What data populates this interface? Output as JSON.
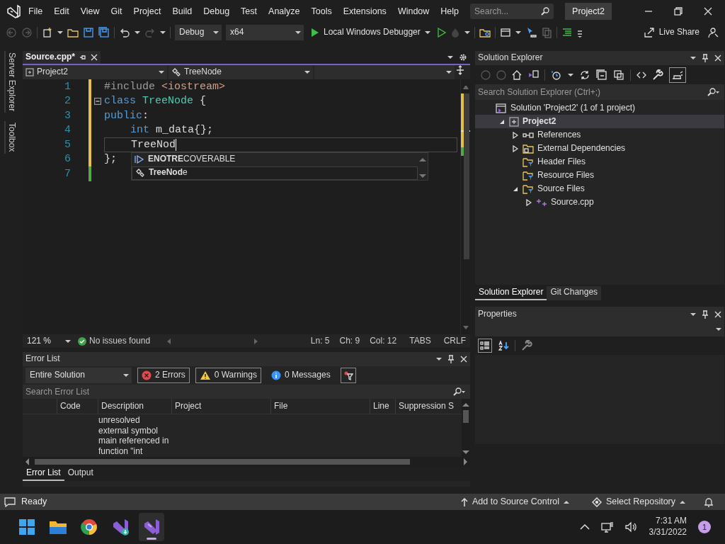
{
  "menu_bar": {
    "items": [
      "File",
      "Edit",
      "View",
      "Git",
      "Project",
      "Build",
      "Debug",
      "Test",
      "Analyze",
      "Tools",
      "Extensions",
      "Window",
      "Help"
    ],
    "search": {
      "placeholder": "Search..."
    },
    "solution_name": "Project2"
  },
  "toolbar": {
    "configuration": "Debug",
    "platform": "x64",
    "debugger": "Local Windows Debugger",
    "live_share": "Live Share"
  },
  "side_tabs": [
    "Server Explorer",
    "Toolbox"
  ],
  "editor": {
    "tabs": [
      {
        "label": "Source.cpp*",
        "selected": true
      }
    ],
    "nav": {
      "project": "Project2",
      "scope": "TreeNode"
    },
    "lines": [
      {
        "number": "1",
        "saved": false,
        "indented": false,
        "tokens": [
          {
            "kind": "preproc",
            "text": "#include"
          },
          {
            "kind": "string",
            "text": " <iostream>"
          }
        ]
      },
      {
        "number": "2",
        "saved": false,
        "fold": true,
        "indented": false,
        "tokens": [
          {
            "kind": "keyword",
            "text": "class"
          },
          {
            "kind": "type",
            "text": " TreeNode"
          },
          {
            "kind": "plain",
            "text": " {"
          }
        ]
      },
      {
        "number": "3",
        "saved": false,
        "indented": false,
        "tokens": [
          {
            "kind": "keyword",
            "text": "public"
          },
          {
            "kind": "plain",
            "text": ":"
          }
        ]
      },
      {
        "number": "4",
        "saved": false,
        "indented": true,
        "tokens": [
          {
            "kind": "keyword",
            "text": "int"
          },
          {
            "kind": "plain",
            "text": " m_data{};"
          }
        ]
      },
      {
        "number": "5",
        "saved": false,
        "indented": true,
        "current": true,
        "tokens": [
          {
            "kind": "plain",
            "text": "TreeNod"
          }
        ]
      },
      {
        "number": "6",
        "saved": false,
        "indented": false,
        "tokens": [
          {
            "kind": "plain",
            "text": "};"
          }
        ]
      },
      {
        "number": "7",
        "saved": true
      }
    ],
    "completion": {
      "items": [
        {
          "kind": "constant",
          "text": "**ENOTRE**COVERABLE",
          "selected": false
        },
        {
          "kind": "class",
          "text": "**TreeNod**e",
          "selected": true
        }
      ]
    },
    "status": {
      "zoom": "121 %",
      "health": "No issues found",
      "ln": "Ln: 5",
      "ch": "Ch: 9",
      "col": "Col: 12",
      "indent": "TABS",
      "line_ending": "CRLF"
    }
  },
  "error_list": {
    "title": "Error List",
    "scope": "Entire Solution",
    "filters": [
      {
        "kind": "error",
        "label": "2 Errors",
        "selected": true
      },
      {
        "kind": "warning",
        "label": "0 Warnings",
        "selected": true
      },
      {
        "kind": "message",
        "label": "0 Messages",
        "selected": false
      }
    ],
    "search": {
      "placeholder": "Search Error List"
    },
    "columns": [
      "Code",
      "Description",
      "Project",
      "File",
      "Line",
      "Suppression S"
    ],
    "rows": [
      {
        "description": "unresolved external symbol main referenced in function \"int"
      }
    ]
  },
  "bottom_tabs": [
    {
      "label": "Error List",
      "selected": true
    },
    {
      "label": "Output",
      "selected": false
    }
  ],
  "solution_explorer": {
    "title": "Solution Explorer",
    "search": {
      "placeholder": "Search Solution Explorer (Ctrl+;)"
    },
    "tree": [
      {
        "kind": "solution",
        "label": "Solution 'Project2' (1 of 1 project)",
        "selected": false,
        "children": [
          {
            "kind": "project",
            "label": "Project2",
            "expanded": true,
            "selected": true,
            "children": [
              {
                "kind": "references",
                "label": "References",
                "expanded": false,
                "selected": false
              },
              {
                "kind": "external",
                "label": "External Dependencies",
                "expanded": false,
                "selected": false
              },
              {
                "kind": "filter",
                "label": "Header Files",
                "selected": false
              },
              {
                "kind": "filter",
                "label": "Resource Files",
                "selected": false
              },
              {
                "kind": "filter",
                "label": "Source Files",
                "expanded": true,
                "selected": false,
                "children": [
                  {
                    "kind": "cpp",
                    "label": "Source.cpp",
                    "expanded": false,
                    "selected": false
                  }
                ]
              }
            ]
          }
        ]
      }
    ]
  },
  "right_tabs": [
    {
      "label": "Solution Explorer",
      "selected": true
    },
    {
      "label": "Git Changes",
      "selected": false
    }
  ],
  "properties": {
    "title": "Properties"
  },
  "status_bar": {
    "message": "Ready",
    "source_control": "Add to Source Control",
    "repository": "Select Repository"
  },
  "taskbar": {
    "apps": [
      {
        "kind": "start",
        "selected": false
      },
      {
        "kind": "files",
        "selected": false
      },
      {
        "kind": "browser",
        "selected": false
      },
      {
        "kind": "installer",
        "selected": false
      },
      {
        "kind": "studio",
        "selected": true
      }
    ],
    "time": "7:31 AM",
    "date": "3/31/2022",
    "notifications": "1"
  }
}
